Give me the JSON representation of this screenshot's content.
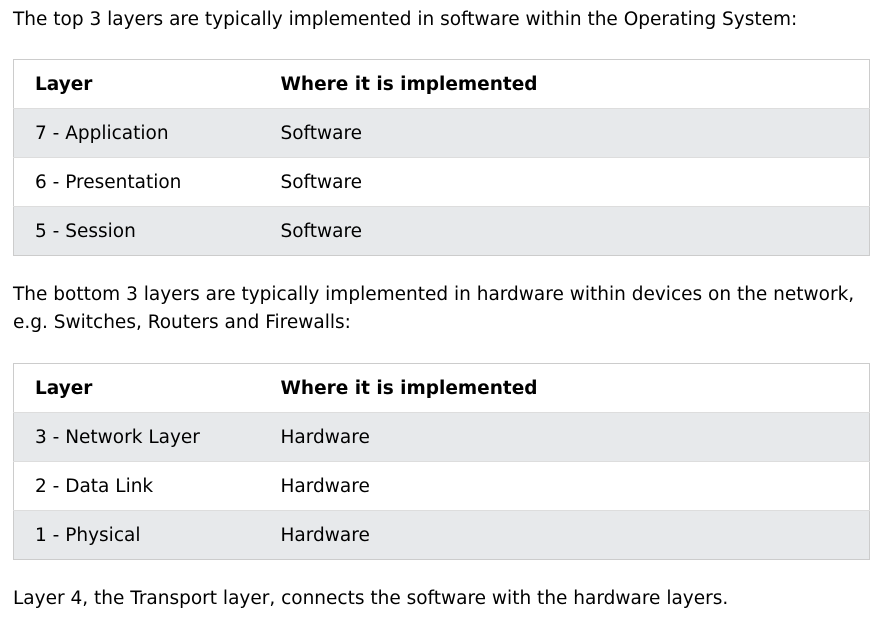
{
  "intro_top": "The top 3 layers are typically implemented in software within the Operating System:",
  "table_top": {
    "headers": [
      "Layer",
      "Where it is implemented"
    ],
    "rows": [
      [
        "7 - Application",
        "Software"
      ],
      [
        "6 - Presentation",
        "Software"
      ],
      [
        "5 - Session",
        "Software"
      ]
    ]
  },
  "intro_bottom": "The bottom 3 layers are typically implemented in hardware within devices on the network, e.g. Switches, Routers and Firewalls:",
  "table_bottom": {
    "headers": [
      "Layer",
      "Where it is implemented"
    ],
    "rows": [
      [
        "3 - Network Layer",
        "Hardware"
      ],
      [
        "2 - Data Link",
        "Hardware"
      ],
      [
        "1 - Physical",
        "Hardware"
      ]
    ]
  },
  "outro": "Layer 4, the Transport layer, connects the software with the hardware layers."
}
